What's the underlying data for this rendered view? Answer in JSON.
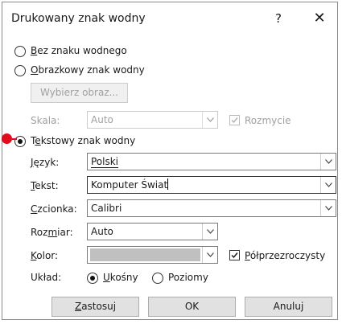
{
  "dialog": {
    "title": "Drukowany znak wodny",
    "help_label": "?",
    "close_label": "✕"
  },
  "options": {
    "none": {
      "first": "B",
      "rest": "ez znaku wodnego",
      "checked": false
    },
    "picture": {
      "first": "O",
      "rest": "brazkowy znak wodny",
      "checked": false
    },
    "text": {
      "pre": "T",
      "underlined": "e",
      "rest": "kstowy znak wodny",
      "checked": true
    }
  },
  "picture_section": {
    "select_button": "Wybierz obraz...",
    "scale_label": "Skala:",
    "scale_value": "Auto",
    "washout_label": "Rozmycie",
    "washout_checked": true
  },
  "text_section": {
    "language": {
      "first": "J",
      "rest": "ęzyk:",
      "value": "Polski"
    },
    "text": {
      "first": "T",
      "rest": "ekst:",
      "value": "Komputer Świat"
    },
    "font": {
      "first": "C",
      "rest": "zcionka:",
      "value": "Calibri"
    },
    "size": {
      "pre": "Roz",
      "underlined": "m",
      "rest": "iar:",
      "value": "Auto"
    },
    "color": {
      "first": "K",
      "rest": "olor:",
      "value_color": "#c0c0c0"
    },
    "semitransparent": {
      "first": "P",
      "rest": "ółprzezroczysty",
      "checked": true
    },
    "layout": {
      "label": "Układ:",
      "diagonal": {
        "first": "U",
        "rest": "kośny",
        "checked": true
      },
      "horizontal": {
        "label": "Poziomy",
        "checked": false
      }
    }
  },
  "buttons": {
    "apply": {
      "first": "Z",
      "rest": "astosuj"
    },
    "ok": "OK",
    "cancel": "Anuluj"
  },
  "colors": {
    "marker": "#e00b1c"
  }
}
